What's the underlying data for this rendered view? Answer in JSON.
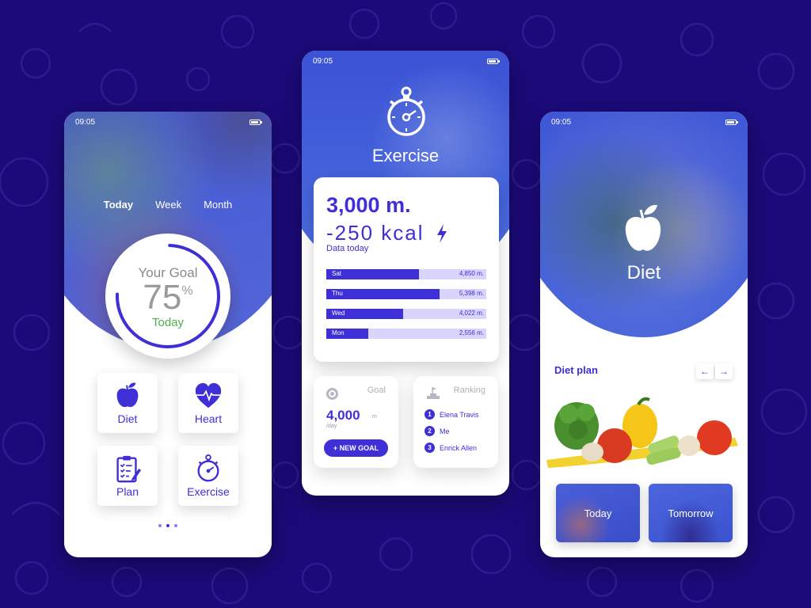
{
  "theme": {
    "accent": "#3f2fd6",
    "background": "#1c0a7a",
    "goal_green": "#4caf50",
    "bar_track": "#d8d4fb"
  },
  "status_bar": {
    "time": "09:05",
    "battery_icon": "battery-icon"
  },
  "screen_goal": {
    "tabs": [
      {
        "label": "Today",
        "active": true
      },
      {
        "label": "Week",
        "active": false
      },
      {
        "label": "Month",
        "active": false
      }
    ],
    "goal": {
      "label": "Your Goal",
      "value": "75",
      "unit": "%",
      "progress_percent": 75,
      "period": "Today"
    },
    "tiles": [
      {
        "label": "Diet",
        "icon": "apple-icon"
      },
      {
        "label": "Heart",
        "icon": "heart-pulse-icon"
      },
      {
        "label": "Plan",
        "icon": "clipboard-icon"
      },
      {
        "label": "Exercise",
        "icon": "stopwatch-icon"
      }
    ],
    "pager": {
      "pages": 3,
      "active_index": 1
    }
  },
  "screen_exercise": {
    "title": "Exercise",
    "distance": "3,000 m.",
    "kcal": "-250 kcal",
    "data_label": "Data today",
    "bars": [
      {
        "day": "Sat",
        "value": "4,850 m.",
        "fill": 0.58
      },
      {
        "day": "Thu",
        "value": "5,398 m.",
        "fill": 0.71
      },
      {
        "day": "Wed",
        "value": "4,022 m.",
        "fill": 0.48
      },
      {
        "day": "Mon",
        "value": "2,556 m.",
        "fill": 0.26
      }
    ],
    "goal_card": {
      "title": "Goal",
      "value": "4,000",
      "unit": "m",
      "per": "/day",
      "button": "+ NEW GOAL"
    },
    "ranking_card": {
      "title": "Ranking",
      "entries": [
        {
          "rank": "1",
          "name": "Elena Travis"
        },
        {
          "rank": "2",
          "name": "Me"
        },
        {
          "rank": "3",
          "name": "Enrick Allen"
        }
      ]
    }
  },
  "screen_diet": {
    "title": "Diet",
    "plan_title": "Diet plan",
    "prev_arrow": "←",
    "next_arrow": "→",
    "cards": [
      {
        "label": "Today"
      },
      {
        "label": "Tomorrow"
      }
    ]
  }
}
